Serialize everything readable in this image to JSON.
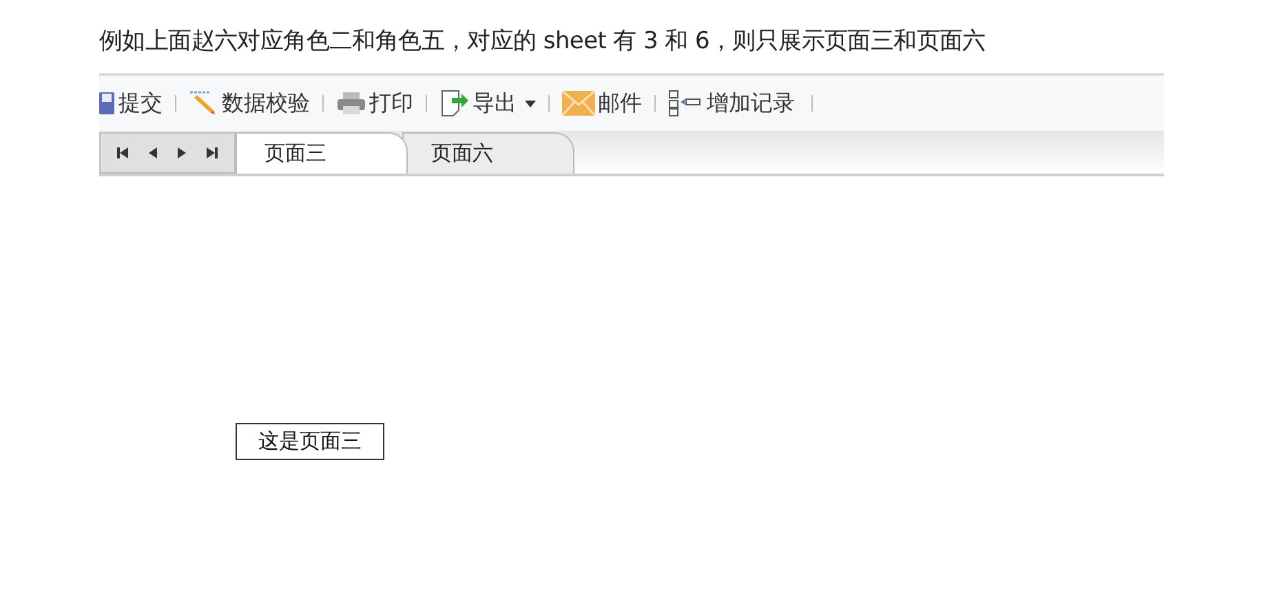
{
  "caption": "例如上面赵六对应角色二和角色五，对应的 sheet 有 3 和 6，则只展示页面三和页面六",
  "toolbar": [
    {
      "kind": "submit",
      "label": "提交",
      "has_menu": false
    },
    {
      "kind": "validate",
      "label": "数据校验",
      "has_menu": false
    },
    {
      "kind": "print",
      "label": "打印",
      "has_menu": false
    },
    {
      "kind": "export",
      "label": "导出",
      "has_menu": true
    },
    {
      "kind": "mail",
      "label": "邮件",
      "has_menu": false
    },
    {
      "kind": "add",
      "label": "增加记录",
      "has_menu": false
    }
  ],
  "sheet_tabs": [
    {
      "label": "页面三",
      "selected": true
    },
    {
      "label": "页面六",
      "selected": false
    }
  ],
  "content": {
    "cell_text": "这是页面三"
  }
}
